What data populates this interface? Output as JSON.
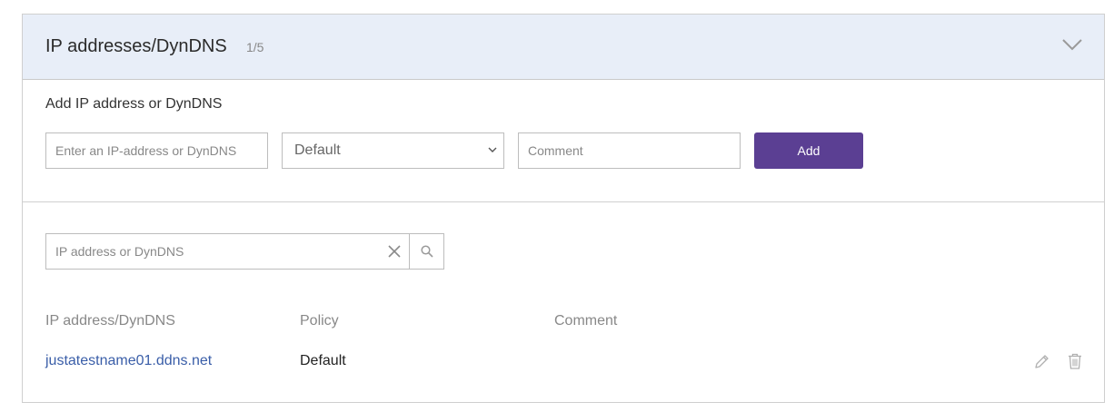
{
  "header": {
    "title": "IP addresses/DynDNS",
    "count": "1/5",
    "collapse_icon": "chevron-down-icon"
  },
  "add_form": {
    "title": "Add IP address or DynDNS",
    "ip_placeholder": "Enter an IP-address or DynDNS",
    "ip_value": "",
    "policy_selected": "Default",
    "comment_placeholder": "Comment",
    "comment_value": "",
    "add_label": "Add"
  },
  "search": {
    "placeholder": "IP address or DynDNS",
    "value": "",
    "clear_icon": "close-icon",
    "search_icon": "search-icon"
  },
  "table": {
    "columns": [
      "IP address/DynDNS",
      "Policy",
      "Comment"
    ],
    "rows": [
      {
        "address": "justatestname01.ddns.net",
        "policy": "Default",
        "comment": ""
      }
    ],
    "row_actions": [
      "edit-icon",
      "trash-icon"
    ]
  },
  "colors": {
    "header_bg": "#e8eef8",
    "accent": "#5b3f93",
    "link": "#3a5ea8",
    "muted_text": "#888888"
  }
}
